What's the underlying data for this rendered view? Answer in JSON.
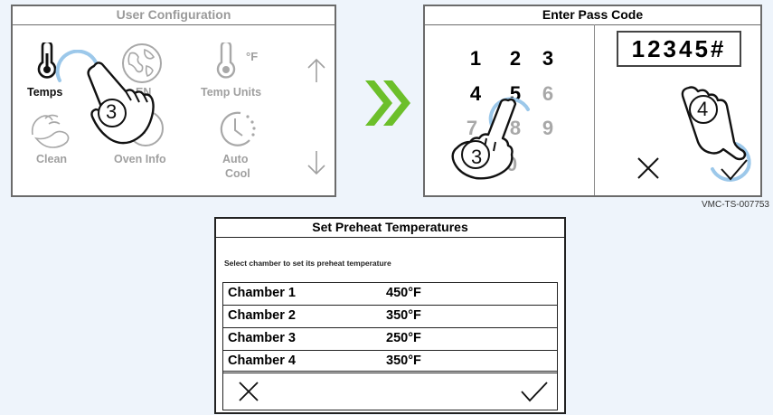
{
  "user_config": {
    "title": "User Configuration",
    "items": [
      {
        "label": "Temps",
        "icon": "thermometer-icon"
      },
      {
        "label": "EN",
        "icon": "globe-icon"
      },
      {
        "label": "Temp Units",
        "unit_symbol": "°F",
        "icon": "thermometer-fahrenheit-icon"
      },
      {
        "label": "Clean",
        "icon": "clean-hands-icon"
      },
      {
        "label": "Oven Info",
        "symbol": "?",
        "icon": "question-icon"
      },
      {
        "label": "Auto",
        "label2": "Cool",
        "icon": "auto-cool-icon"
      }
    ],
    "step_number": "3"
  },
  "pass_code": {
    "title": "Enter Pass Code",
    "keys": [
      "1",
      "2",
      "3",
      "4",
      "5",
      "6",
      "7",
      "8",
      "9",
      "0"
    ],
    "entered": "12345#",
    "step_enter": "3",
    "step_confirm": "4"
  },
  "reference": "VMC-TS-007753",
  "preheat": {
    "title": "Set Preheat Temperatures",
    "subtitle": "Select chamber to set its preheat temperature",
    "chambers": [
      {
        "name": "Chamber 1",
        "temp": "450°F"
      },
      {
        "name": "Chamber 2",
        "temp": "350°F"
      },
      {
        "name": "Chamber 3",
        "temp": "250°F"
      },
      {
        "name": "Chamber 4",
        "temp": "350°F"
      }
    ]
  },
  "colors": {
    "accent_green": "#6cbf2a",
    "ripple_blue": "#9cc8ea",
    "dim_gray": "#a0a0a0"
  }
}
